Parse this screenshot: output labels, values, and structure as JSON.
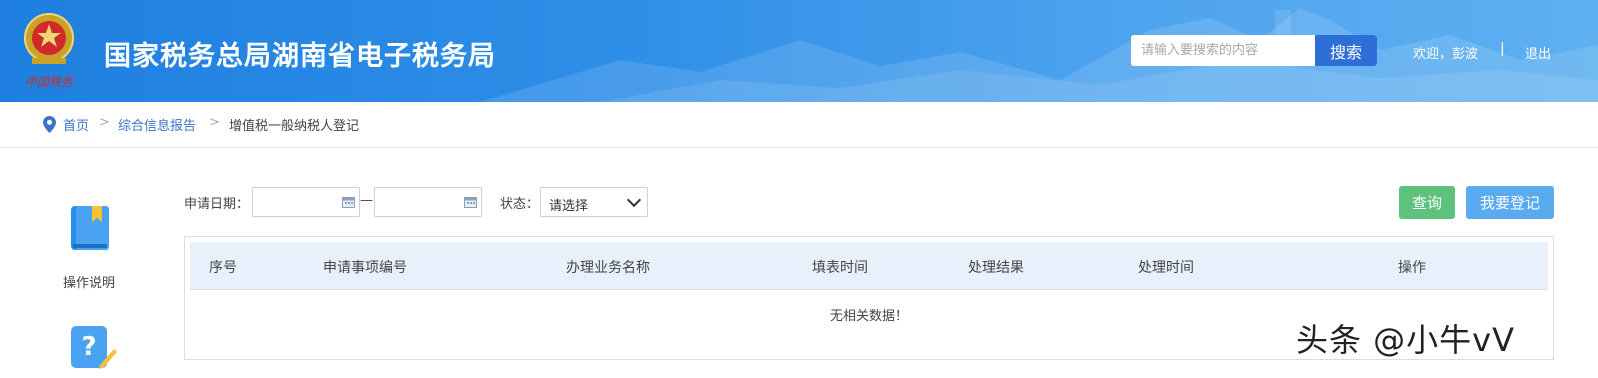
{
  "header": {
    "emblem_text": "中国税务",
    "site_title": "国家税务总局湖南省电子税务局",
    "search": {
      "placeholder": "请输入要搜索的内容",
      "button_label": "搜索"
    },
    "welcome": "欢迎，彭波",
    "separator": "|",
    "logout": "退出"
  },
  "breadcrumb": {
    "items": [
      "首页",
      "综合信息报告",
      "增值税一般纳税人登记"
    ],
    "separator": ">"
  },
  "sidebar": {
    "items": [
      {
        "label": "操作说明",
        "icon": "book-icon"
      },
      {
        "label": "",
        "icon": "question-edit-icon"
      }
    ]
  },
  "filter": {
    "date_label": "申请日期：",
    "date_start": "",
    "date_end": "",
    "range_dash": "—",
    "status_label": "状态：",
    "status_selected": "请选择",
    "query_button": "查询",
    "register_button": "我要登记"
  },
  "table": {
    "columns": [
      "序号",
      "申请事项编号",
      "办理业务名称",
      "填表时间",
      "处理结果",
      "处理时间",
      "操作"
    ],
    "rows": [],
    "empty_text": "无相关数据！"
  },
  "watermark": "头条 @小牛vV",
  "colors": {
    "header_start": "#1e7fe0",
    "header_end": "#5eb0f0",
    "search_button": "#2d6fd6",
    "query_button": "#5cc27c",
    "register_button": "#5aaaf0",
    "table_header": "#e8f1fb",
    "link": "#3a73c9"
  }
}
